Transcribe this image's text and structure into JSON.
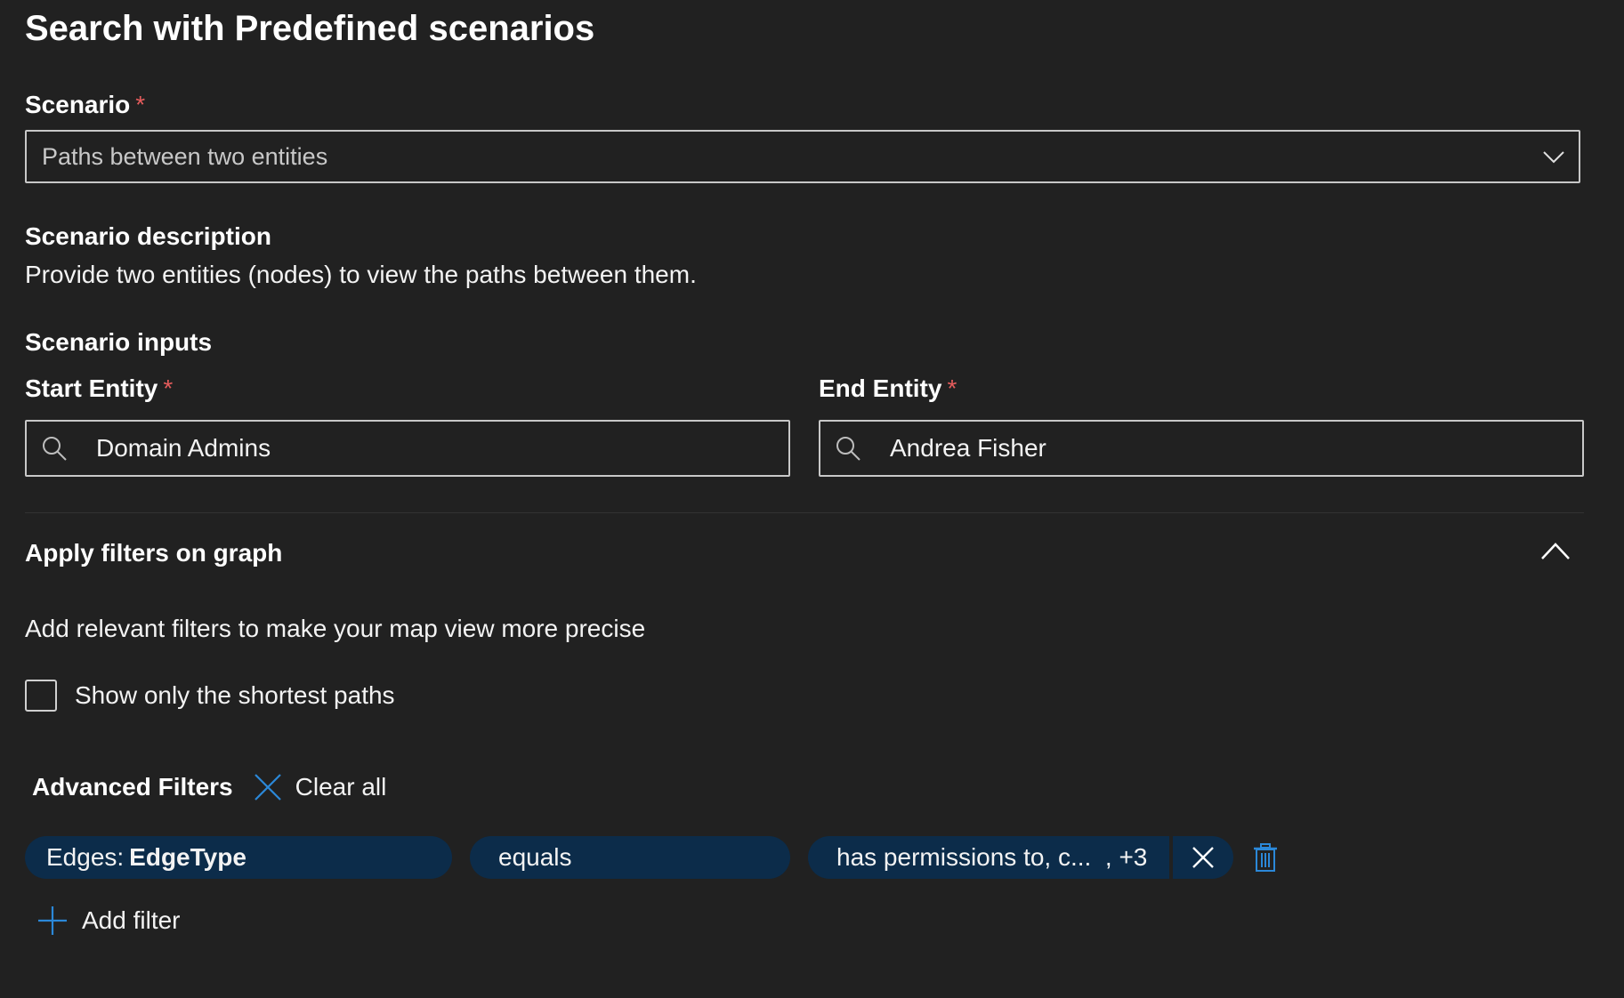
{
  "page": {
    "title": "Search with Predefined scenarios",
    "required_marker": "*"
  },
  "scenario": {
    "label": "Scenario",
    "selected": "Paths between two entities",
    "icon": "chevron-down-icon"
  },
  "description": {
    "label": "Scenario description",
    "text": "Provide two entities (nodes) to view the paths between them."
  },
  "inputs": {
    "label": "Scenario inputs",
    "start": {
      "label": "Start Entity",
      "value": "Domain Admins",
      "icon": "search-icon"
    },
    "end": {
      "label": "End Entity",
      "value": "Andrea Fisher",
      "icon": "search-icon"
    }
  },
  "filters": {
    "section_label": "Apply filters on graph",
    "section_icon": "chevron-up-icon",
    "hint": "Add relevant filters to make your map view more precise",
    "shortest_paths": {
      "label": "Show only the shortest paths",
      "checked": false
    },
    "advanced": {
      "label": "Advanced Filters",
      "clear_all": "Clear all",
      "clear_icon": "close-icon"
    },
    "rule": {
      "field_prefix": "Edges:",
      "field_name": "EdgeType",
      "operator": "equals",
      "value": "has permissions to, c...  , +3",
      "remove_icon": "close-icon",
      "delete_icon": "trash-icon"
    },
    "add_filter": {
      "label": "Add filter",
      "icon": "plus-icon"
    }
  },
  "colors": {
    "background": "#212121",
    "pill": "#0c2c4a",
    "accent": "#2b88d8",
    "required": "#e55c5c"
  }
}
